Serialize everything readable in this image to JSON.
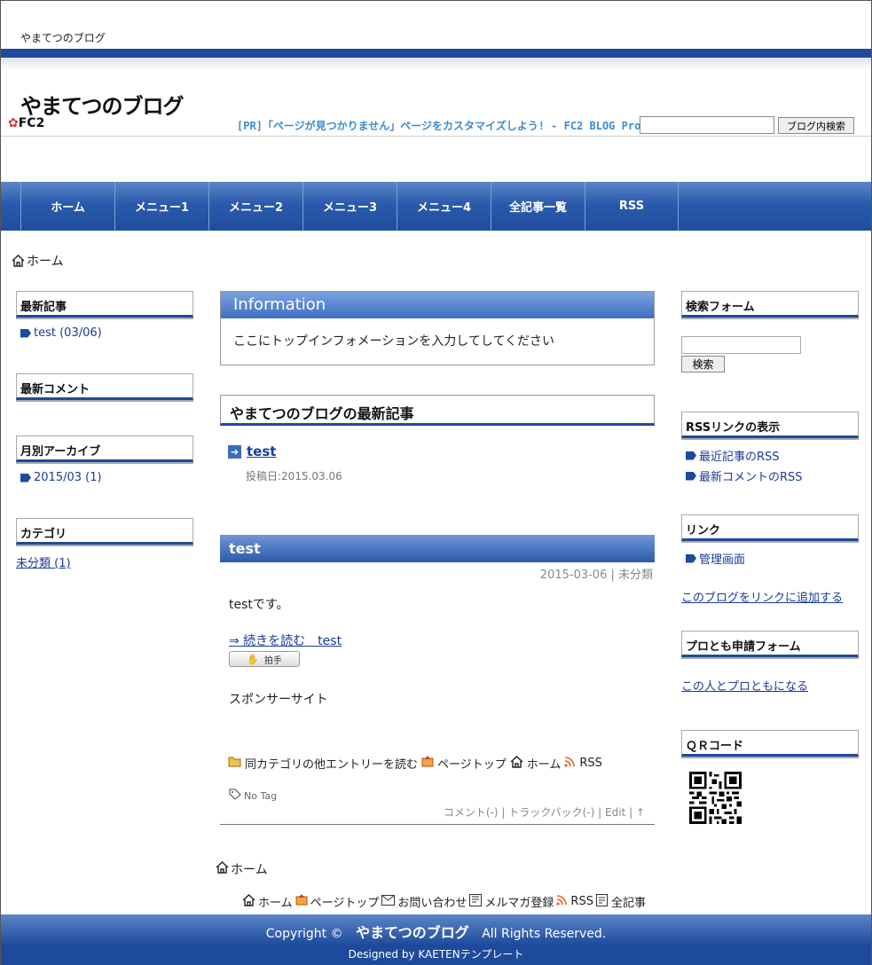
{
  "topbar": {
    "title": "やまてつのブログ"
  },
  "header": {
    "blog_title": "やまてつのブログ",
    "fc2_logo": "FC2",
    "pr_link": "[PR]「ページが見つかりません」ページをカスタマイズしよう! - FC2 BLOG Pro",
    "search_button": "ブログ内検索"
  },
  "nav": {
    "items": [
      {
        "label": "ホーム"
      },
      {
        "label": "メニュー1"
      },
      {
        "label": "メニュー2"
      },
      {
        "label": "メニュー3"
      },
      {
        "label": "メニュー4"
      },
      {
        "label": "全記事一覧"
      },
      {
        "label": "RSS"
      }
    ]
  },
  "breadcrumb": {
    "home": "ホーム"
  },
  "left_sidebar": {
    "recent_entries_title": "最新記事",
    "recent_entry": "test (03/06)",
    "recent_comments_title": "最新コメント",
    "archive_title": "月別アーカイブ",
    "archive_item": "2015/03 (1)",
    "category_title": "カテゴリ",
    "category_item": "未分類 (1)"
  },
  "info": {
    "title": "Information",
    "text": "ここにトップインフォメーションを入力してしてください"
  },
  "latest": {
    "heading": "やまてつのブログの最新記事",
    "entry_title": "test",
    "entry_date": "投稿日:2015.03.06"
  },
  "entry": {
    "title": "test",
    "meta": "2015-03-06 | 未分類",
    "body": "testです。",
    "read_more": "⇒ 続きを読む　test",
    "clap": "拍手",
    "sponsor": "スポンサーサイト",
    "link_category": "同カテゴリの他エントリーを読む",
    "link_pagetop": "ページトップ",
    "link_home": "ホーム",
    "link_rss": "RSS",
    "no_tag": "No Tag",
    "footer": "コメント(-) | トラックバック(-) | Edit | ↑"
  },
  "right_sidebar": {
    "search_title": "検索フォーム",
    "search_button": "検索",
    "rss_title": "RSSリンクの表示",
    "rss_recent": "最近記事のRSS",
    "rss_comments": "最新コメントのRSS",
    "links_title": "リンク",
    "links_admin": "管理画面",
    "links_add": "このブログをリンクに追加する",
    "protomo_title": "プロとも申請フォーム",
    "protomo_link": "この人とプロともになる",
    "qr_title": "ＱＲコード"
  },
  "footer": {
    "home": "ホーム",
    "link_home": "ホーム",
    "link_pagetop": "ページトップ",
    "link_contact": "お問い合わせ",
    "link_magazine": "メルマガ登録",
    "link_rss": "RSS",
    "link_all": "全記事",
    "copyright_prefix": "Copyright ©",
    "copyright_blog": "やまてつのブログ",
    "copyright_suffix": "All Rights Reserved.",
    "designed": "Designed by KAETENテンプレート"
  },
  "colors": {
    "accent": "#1e4a9c",
    "link": "#1a3a9a"
  }
}
